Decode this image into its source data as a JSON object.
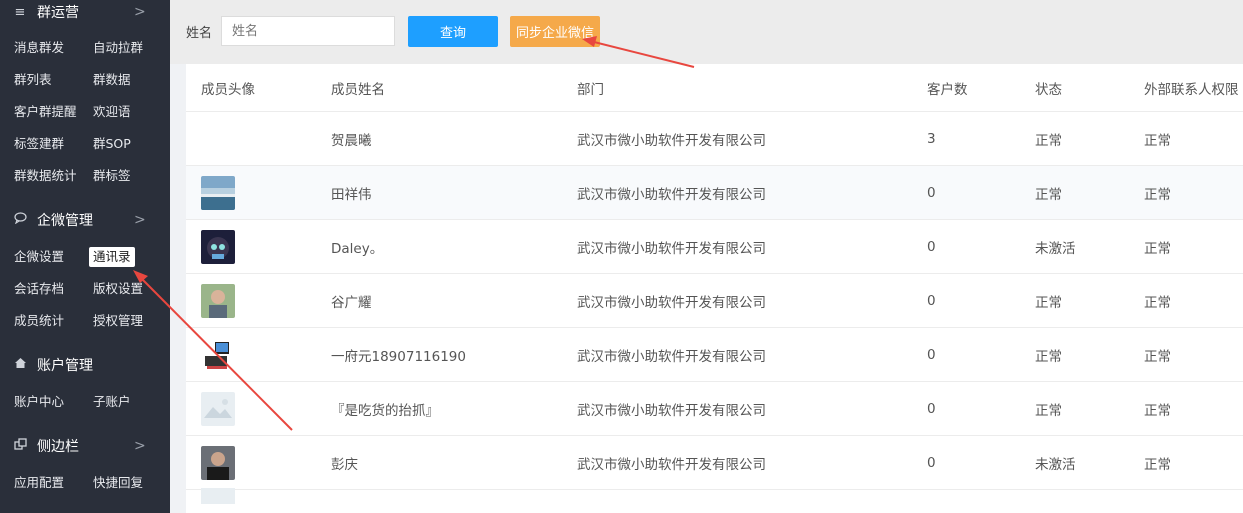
{
  "sidebar": {
    "groups": [
      {
        "icon": "menu-lines-icon",
        "title": "群运营"
      },
      {
        "icon": "chat-bubble-icon",
        "title": "企微管理"
      },
      {
        "icon": "home-icon",
        "title": "账户管理"
      },
      {
        "icon": "windows-icon",
        "title": "侧边栏"
      }
    ],
    "items": {
      "g1": [
        "消息群发",
        "自动拉群",
        "群列表",
        "群数据",
        "客户群提醒",
        "欢迎语",
        "标签建群",
        "群SOP",
        "群数据统计",
        "群标签"
      ],
      "g2": [
        "企微设置",
        "通讯录",
        "会话存档",
        "版权设置",
        "成员统计",
        "授权管理"
      ],
      "g3": [
        "账户中心",
        "子账户"
      ],
      "g4": [
        "应用配置",
        "快捷回复"
      ]
    },
    "active_item": "通讯录"
  },
  "toolbar": {
    "name_label": "姓名",
    "name_placeholder": "姓名",
    "name_value": "",
    "query_label": "查询",
    "sync_label": "同步企业微信",
    "colors": {
      "query": "#1e9fff",
      "sync": "#f5a94a",
      "annotation_arrow": "#e8473f"
    }
  },
  "table": {
    "headers": {
      "avatar": "成员头像",
      "name": "成员姓名",
      "dept": "部门",
      "customers": "客户数",
      "status": "状态",
      "ext_perm": "外部联系人权限"
    },
    "rows": [
      {
        "avatar": "none",
        "name": "贺晨曦",
        "dept": "武汉市微小助软件开发有限公司",
        "customers": "3",
        "status": "正常",
        "ext_perm": "正常"
      },
      {
        "avatar": "landscape",
        "name": "田祥伟",
        "dept": "武汉市微小助软件开发有限公司",
        "customers": "0",
        "status": "正常",
        "ext_perm": "正常"
      },
      {
        "avatar": "anime",
        "name": "Daley。",
        "dept": "武汉市微小助软件开发有限公司",
        "customers": "0",
        "status": "未激活",
        "ext_perm": "正常"
      },
      {
        "avatar": "person",
        "name": "谷广耀",
        "dept": "武汉市微小助软件开发有限公司",
        "customers": "0",
        "status": "正常",
        "ext_perm": "正常"
      },
      {
        "avatar": "device",
        "name": "一府元18907116190",
        "dept": "武汉市微小助软件开发有限公司",
        "customers": "0",
        "status": "正常",
        "ext_perm": "正常"
      },
      {
        "avatar": "placeholder",
        "name": "『是吃货的抬抓』",
        "dept": "武汉市微小助软件开发有限公司",
        "customers": "0",
        "status": "正常",
        "ext_perm": "正常"
      },
      {
        "avatar": "dark-person",
        "name": "彭庆",
        "dept": "武汉市微小助软件开发有限公司",
        "customers": "0",
        "status": "未激活",
        "ext_perm": "正常"
      }
    ]
  }
}
